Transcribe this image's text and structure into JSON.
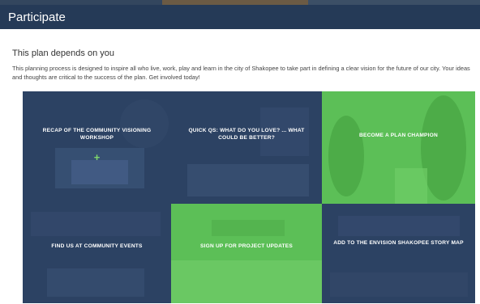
{
  "header": {
    "title": "Participate"
  },
  "section": {
    "heading": "This plan depends on you",
    "intro": "This planning process is designed to inspire all who live, work, play and learn in the city of Shakopee to take part in defining a clear vision for the future of our city. Your ideas and thoughts are critical to the success of the plan. Get involved today!"
  },
  "tiles": [
    {
      "label": "RECAP OF THE COMMUNITY VISIONING WORKSHOP",
      "color": "#2c4263",
      "icon": "plus-icon",
      "icon_glyph": "+"
    },
    {
      "label": "QUICK QS: WHAT DO YOU LOVE? ... WHAT COULD BE BETTER?",
      "color": "#2c4263"
    },
    {
      "label": "BECOME A PLAN CHAMPION",
      "color": "#5cbf57"
    },
    {
      "label": "FIND US AT COMMUNITY EVENTS",
      "color": "#2c4263"
    },
    {
      "label": "SIGN UP FOR PROJECT UPDATES",
      "color": "#5cbf57"
    },
    {
      "label": "ADD TO THE ENVISION SHAKOPEE STORY MAP",
      "color": "#2c4263"
    }
  ],
  "colors": {
    "header": "#253a57",
    "navy": "#2c4263",
    "green": "#5cbf57"
  }
}
